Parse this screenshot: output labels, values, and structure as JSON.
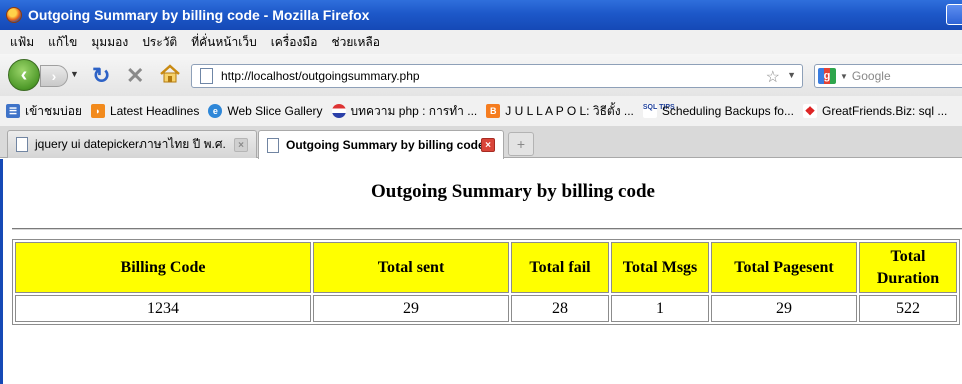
{
  "window": {
    "title": "Outgoing Summary by billing code - Mozilla Firefox"
  },
  "menu": {
    "items": [
      "แฟ้ม",
      "แก้ไข",
      "มุมมอง",
      "ประวัติ",
      "ที่คั่นหน้าเว็บ",
      "เครื่องมือ",
      "ช่วยเหลือ"
    ]
  },
  "navigation": {
    "url": "http://localhost/outgoingsummary.php",
    "search_placeholder": "Google"
  },
  "bookmarks": {
    "items": [
      {
        "label": "เข้าชมบ่อย",
        "icon": "frequent-icon"
      },
      {
        "label": "Latest Headlines",
        "icon": "rss-icon"
      },
      {
        "label": "Web Slice Gallery",
        "icon": "ie-icon"
      },
      {
        "label": "บทความ php : การทำ ...",
        "icon": "site-icon"
      },
      {
        "label": "J U L L A P O L: วิธีตั้ง ...",
        "icon": "blogger-icon"
      },
      {
        "label": "Scheduling Backups fo...",
        "icon": "sql-tips-icon"
      },
      {
        "label": "GreatFriends.Biz: sql ...",
        "icon": "greatfriends-icon"
      }
    ]
  },
  "tabs": [
    {
      "label": "jquery ui datepickerภาษาไทย ปี พ.ศ.",
      "active": false
    },
    {
      "label": "Outgoing Summary by billing code",
      "active": true
    }
  ],
  "page": {
    "title": "Outgoing Summary by billing code",
    "table": {
      "headers": [
        "Billing Code",
        "Total sent",
        "Total fail",
        "Total Msgs",
        "Total Pagesent",
        "Total Duration"
      ],
      "rows": [
        [
          "1234",
          "29",
          "28",
          "1",
          "29",
          "522"
        ]
      ]
    }
  },
  "colors": {
    "header_fill": "#ffff00",
    "titlebar": "#1d58c9"
  }
}
